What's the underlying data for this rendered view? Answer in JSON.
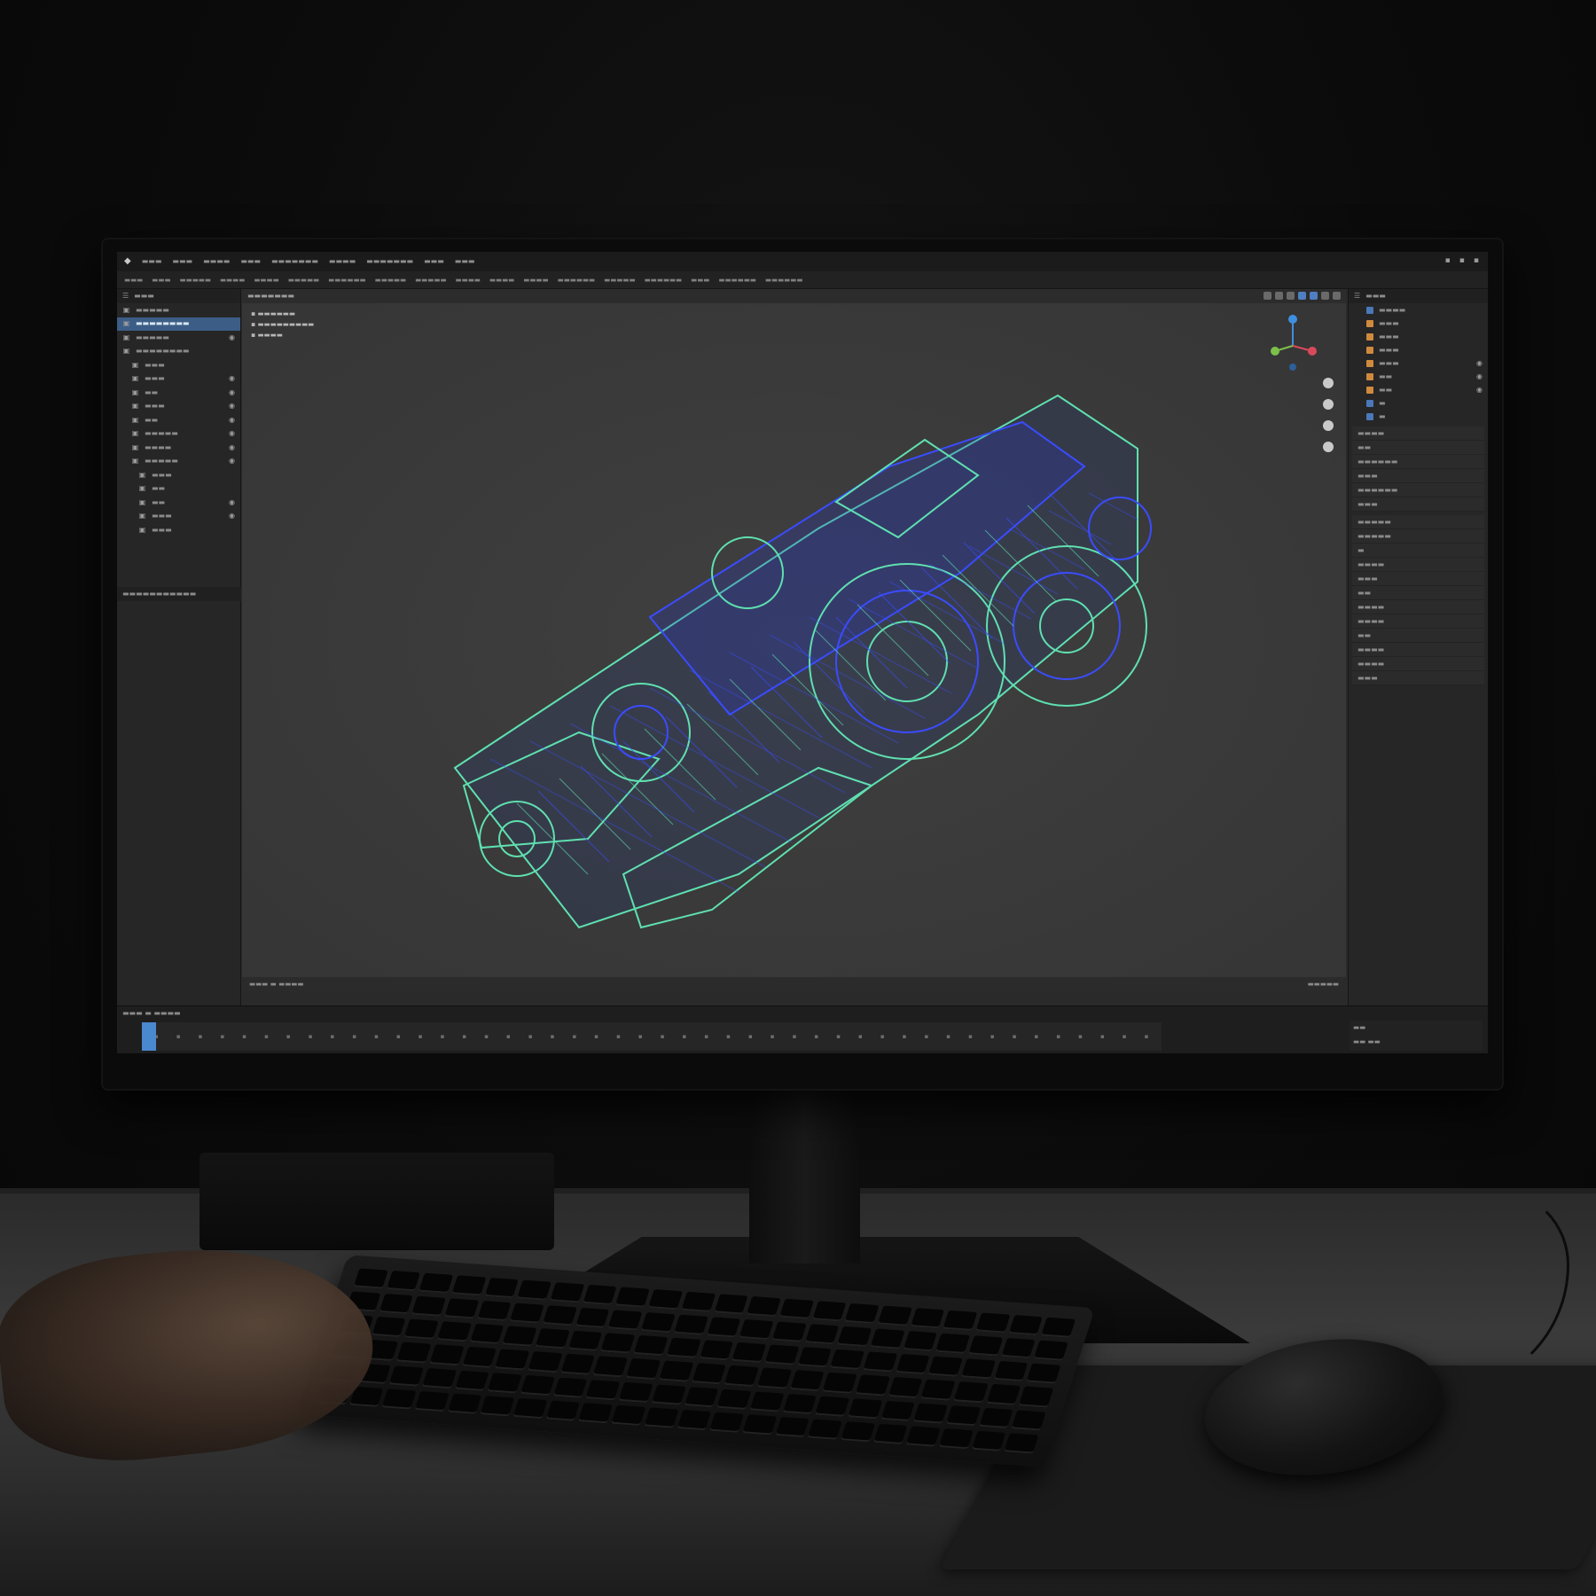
{
  "colors": {
    "selection": "#3c5d86",
    "wire_green": "#5fe0b0",
    "wire_blue": "#3a4cff",
    "viewport_bg": "#3a3a3a",
    "orange_icon": "#d08a3e"
  },
  "icons": [
    "app-logo-icon",
    "eye-icon",
    "axis-gizmo-icon",
    "zoom-icon",
    "pan-icon",
    "camera-icon",
    "grid-icon"
  ],
  "scene_objects": [
    "monitor",
    "keyboard",
    "mouse",
    "mousepad",
    "hand",
    "desk",
    "monitor-stand"
  ]
}
